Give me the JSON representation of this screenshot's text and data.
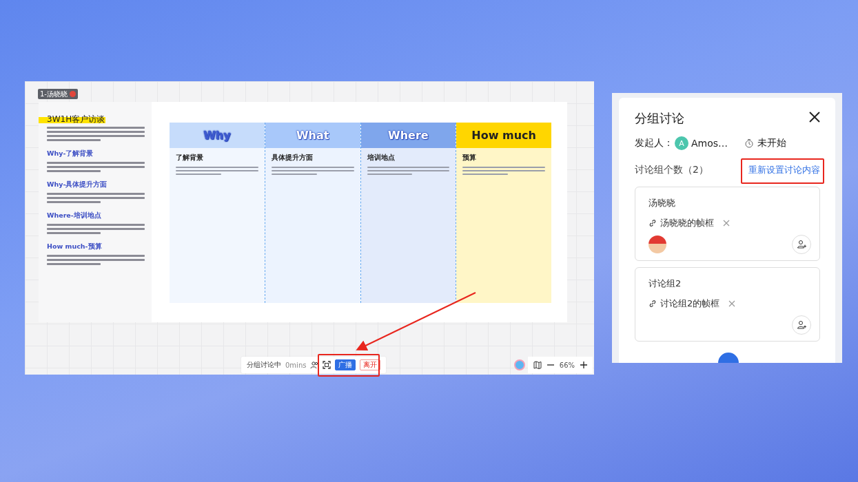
{
  "board_window": {
    "frame_tag": "1-汤晓晓",
    "doc": {
      "title": "3W1H客户访谈",
      "sections": [
        {
          "heading": "Why-了解背景"
        },
        {
          "heading": "Why-具体提升方面"
        },
        {
          "heading": "Where-培训地点"
        },
        {
          "heading": "How much-预算"
        }
      ]
    },
    "table": {
      "columns": [
        {
          "header": "Why",
          "color": "#c6dcfb",
          "subheading": "了解背景"
        },
        {
          "header": "What",
          "color": "#a8c8fa",
          "subheading": "具体提升方面"
        },
        {
          "header": "Where",
          "color": "#7fa6ec",
          "subheading": "培训地点"
        },
        {
          "header": "How much",
          "color": "#ffd600",
          "subheading": "预算"
        }
      ]
    },
    "toolbar": {
      "status": "分组讨论中",
      "timer": "0mins",
      "buttons": [
        {
          "label": "广播",
          "kind": "primary"
        },
        {
          "label": "离开",
          "kind": "danger"
        }
      ],
      "zoom": "66%"
    }
  },
  "panel": {
    "title": "分组讨论",
    "initiator_label": "发起人：",
    "initiator_initial": "A",
    "initiator_name": "Amos…",
    "state": "未开始",
    "count_label": "讨论组个数（2）",
    "reset_link": "重新设置讨论内容",
    "groups": [
      {
        "name": "汤晓晓",
        "frame": "汤晓晓的帧框",
        "has_member": true
      },
      {
        "name": "讨论组2",
        "frame": "讨论组2的帧框",
        "has_member": false
      }
    ]
  }
}
